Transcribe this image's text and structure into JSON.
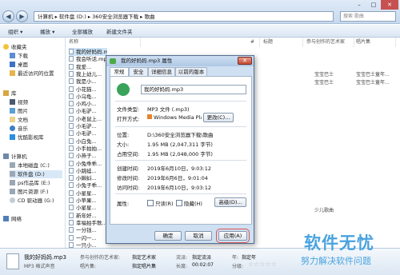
{
  "breadcrumb": [
    "计算机",
    "软件盘 (D:)",
    "360安全浏览器下载",
    "歌曲"
  ],
  "search": {
    "placeholder": "搜索 歌曲"
  },
  "toolbar": {
    "organize": "组织 ▾",
    "play": "播放 ▾",
    "play_all": "全部播放",
    "new_folder": "新建文件夹"
  },
  "nav": {
    "favorites": "收藏夹",
    "downloads": "下载",
    "desktop": "桌面",
    "recent": "最近访问的位置",
    "libraries": "库",
    "videos": "视频",
    "pictures": "图片",
    "documents": "文档",
    "music": "音乐",
    "youku": "优酷影视库",
    "computer": "计算机",
    "local_c": "本地磁盘 (C:)",
    "soft_d": "软件盘 (D:)",
    "ps_e": "ps作品库 (E:)",
    "pic_f": "图片资源 (F:)",
    "cd_g": "CD 驱动器 (G:)",
    "network": "网络"
  },
  "columns": {
    "name": "名称",
    "num": "#",
    "title": "标题",
    "artist": "参与创作的艺术家",
    "album": "唱片集"
  },
  "files": [
    {
      "name": "我的好妈妈.mp3",
      "title": "",
      "artist": "",
      "album": ""
    },
    {
      "name": "我会听话.mp3",
      "title": "",
      "artist": "",
      "album": ""
    },
    {
      "name": "我爱...",
      "title": "",
      "artist": "",
      "album": ""
    },
    {
      "name": "我上幼儿...",
      "title": "",
      "artist": "宝宝巴士",
      "album": "宝宝巴士童年..."
    },
    {
      "name": "我是小...",
      "title": "",
      "artist": "宝宝巴士",
      "album": "宝宝巴士童年..."
    },
    {
      "name": "小花猫...",
      "title": "",
      "artist": "",
      "album": ""
    },
    {
      "name": "小乌龟...",
      "title": "",
      "artist": "",
      "album": ""
    },
    {
      "name": "小鸡小...",
      "title": "",
      "artist": "",
      "album": ""
    },
    {
      "name": "小毛驴...",
      "title": "",
      "artist": "",
      "album": ""
    },
    {
      "name": "小老鼠上...",
      "title": "",
      "artist": "",
      "album": ""
    },
    {
      "name": "小毛驴...",
      "title": "",
      "artist": "",
      "album": ""
    },
    {
      "name": "小毛驴...",
      "title": "",
      "artist": "",
      "album": ""
    },
    {
      "name": "小白兔...",
      "title": "",
      "artist": "",
      "album": ""
    },
    {
      "name": "小手拍拍...",
      "title": "",
      "artist": "",
      "album": ""
    },
    {
      "name": "小燕子...",
      "title": "",
      "artist": "",
      "album": ""
    },
    {
      "name": "小兔乖乖...",
      "title": "",
      "artist": "",
      "album": ""
    },
    {
      "name": "小跳蛙...",
      "title": "",
      "artist": "",
      "album": ""
    },
    {
      "name": "小蝌蚪...",
      "title": "",
      "artist": "",
      "album": ""
    },
    {
      "name": "小兔子乖...",
      "title": "",
      "artist": "",
      "album": ""
    },
    {
      "name": "小星星...",
      "title": "",
      "artist": "",
      "album": ""
    },
    {
      "name": "小苹果...",
      "title": "",
      "artist": "",
      "album": ""
    },
    {
      "name": "小星星...",
      "title": "",
      "artist": "",
      "album": ""
    },
    {
      "name": "新年好...",
      "title": "",
      "artist": "",
      "album": ""
    },
    {
      "name": "幸福拍手歌...",
      "title": "",
      "artist": "",
      "album": ""
    },
    {
      "name": "一分钱...",
      "title": "",
      "artist": "",
      "album": ""
    },
    {
      "name": "一闪一...",
      "title": "",
      "artist": "",
      "album": ""
    },
    {
      "name": "一只小...",
      "title": "",
      "artist": "",
      "album": ""
    }
  ],
  "right_col": [
    {
      "artist": "宝宝巴士",
      "album": "宝宝巴士童年..."
    },
    {
      "artist": "宝宝巴士",
      "album": "宝宝巴士童年..."
    },
    {
      "artist": "少儿歌曲",
      "album": ""
    }
  ],
  "details": {
    "filename": "我的好妈妈.mp3",
    "type": "MP3 格式声音",
    "artist_label": "参与创作的艺术家:",
    "artist_val": "指定艺术家",
    "album_label": "唱片集:",
    "album_val": "指定唱片集",
    "genre_label": "流派:",
    "genre_val": "指定流派",
    "length_label": "长度:",
    "length_val": "00:02:07",
    "year_label": "年:",
    "year_val": "指定年",
    "rating_label": "分级:"
  },
  "dialog": {
    "title": "我的好妈妈.mp3 属性",
    "tabs": [
      "常规",
      "安全",
      "详细信息",
      "以前的版本"
    ],
    "filename": "我的好妈妈.mp3",
    "type_label": "文件类型:",
    "type_val": "MP3 文件 (.mp3)",
    "open_label": "打开方式:",
    "open_val": "Windows Media Playe",
    "change_btn": "更改(C)...",
    "location_label": "位置:",
    "location_val": "D:\\360安全浏览器下载\\歌曲",
    "size_label": "大小:",
    "size_val": "1.95 MB (2,047,311 字节)",
    "disk_label": "占用空间:",
    "disk_val": "1.95 MB (2,048,000 字节)",
    "created_label": "创建时间:",
    "created_val": "2019年6月10日，9:03:12",
    "modified_label": "修改时间:",
    "modified_val": "2019年6月6日，9:01:04",
    "accessed_label": "访问时间:",
    "accessed_val": "2019年6月10日，9:03:12",
    "attr_label": "属性:",
    "readonly": "只读(R)",
    "hidden": "隐藏(H)",
    "advanced_btn": "高级(D)...",
    "ok": "确定",
    "cancel": "取消",
    "apply": "应用(A)"
  },
  "watermark": {
    "line1": "软件无忧",
    "line2": "努力解决软件问题"
  }
}
